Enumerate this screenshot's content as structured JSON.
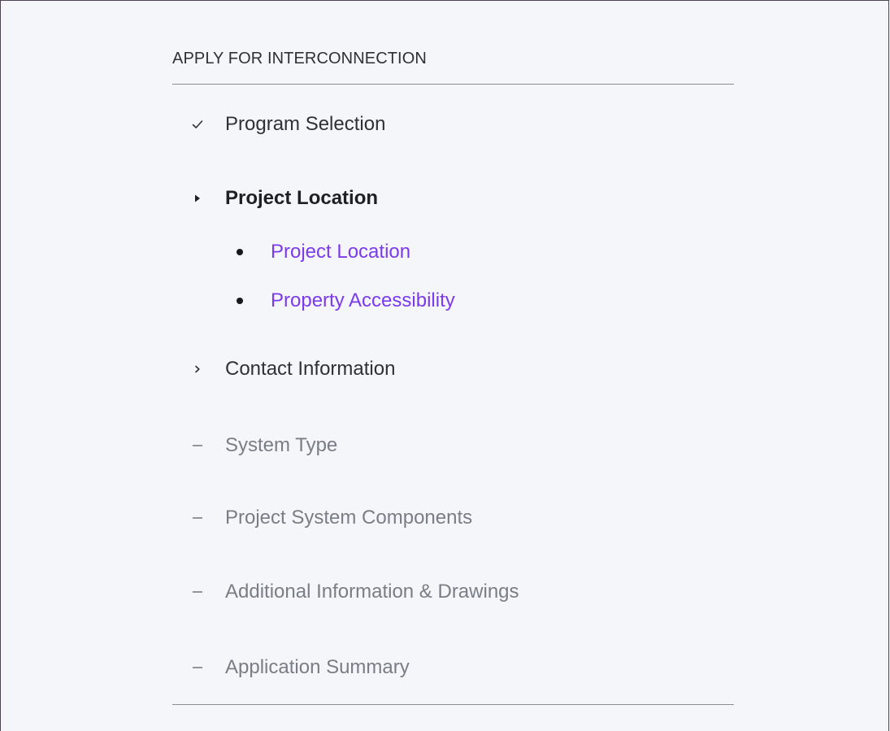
{
  "section": {
    "title": "APPLY FOR INTERCONNECTION"
  },
  "steps": [
    {
      "label": "Program Selection",
      "status": "completed",
      "icon": "check-icon"
    },
    {
      "label": "Project Location",
      "status": "current",
      "icon": "caret-right-filled-icon"
    },
    {
      "label": "Contact Information",
      "status": "next",
      "icon": "chevron-right-icon"
    },
    {
      "label": "System Type",
      "status": "pending",
      "icon": "dash-icon"
    },
    {
      "label": "Project System Components",
      "status": "pending",
      "icon": "dash-icon"
    },
    {
      "label": "Additional Information & Drawings",
      "status": "pending",
      "icon": "dash-icon"
    },
    {
      "label": "Application Summary",
      "status": "pending",
      "icon": "dash-icon"
    }
  ],
  "substeps": [
    {
      "label": "Project Location"
    },
    {
      "label": "Property Accessibility"
    }
  ],
  "colors": {
    "background": "#f5f6fa",
    "link": "#7c3aed",
    "pending_text": "#7a7d85",
    "text": "#2f3136"
  }
}
